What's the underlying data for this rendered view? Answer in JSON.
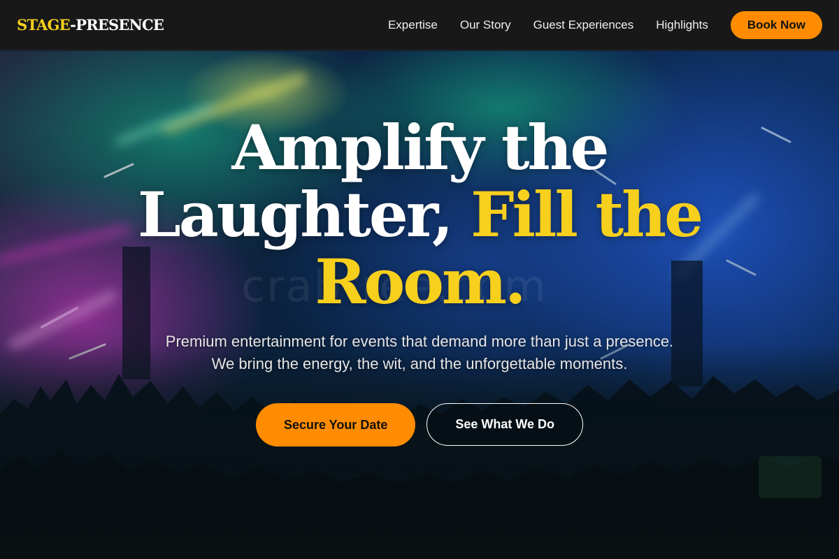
{
  "brand": {
    "logo_part1": "STAGE",
    "logo_part2": "-PRESENCE"
  },
  "nav": {
    "links": [
      "Expertise",
      "Our Story",
      "Guest Experiences",
      "Highlights"
    ],
    "cta_label": "Book Now"
  },
  "hero": {
    "headline_white": "Amplify the Laughter,",
    "headline_accent": "Fill the Room.",
    "subtext_line1": "Premium entertainment for events that demand more than just a presence.",
    "subtext_line2": "We bring the energy, the wit, and the unforgettable moments.",
    "primary_cta": "Secure Your Date",
    "secondary_cta": "See What We Do",
    "watermark": "crabtree.com"
  },
  "colors": {
    "accent_yellow": "#f7cf1d",
    "accent_orange": "#ff8c00",
    "nav_background": "#181818"
  }
}
